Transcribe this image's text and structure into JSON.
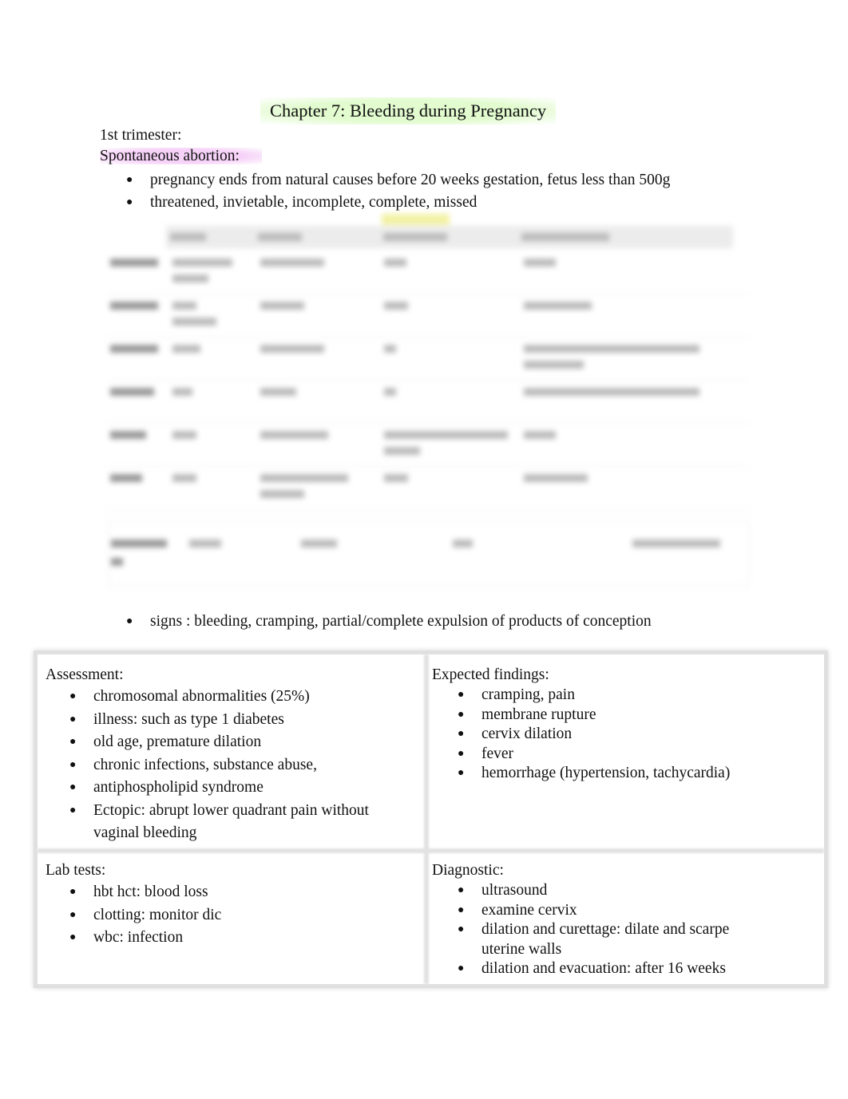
{
  "document": {
    "title": "Chapter 7: Bleeding during Pregnancy",
    "section": "1st trimester:",
    "subsection": "Spontaneous abortion:",
    "bullets": [
      "pregnancy ends from natural causes before 20 weeks gestation, fetus less than 500g",
      "threatened, invietable, incomplete, complete, missed"
    ],
    "table_note": "Table content is blurred / not legible",
    "signs": "signs : bleeding, cramping, partial/complete expulsion of products of conception",
    "highlight_colors": {
      "title": "#e2fbcf",
      "subsection": "#f6d2f8",
      "table_chip": "#f2f2a6"
    }
  },
  "grid": {
    "assessment": {
      "heading": "Assessment:",
      "items": [
        "chromosomal abnormalities (25%)",
        "illness: such as type 1 diabetes",
        "old age, premature dilation",
        "chronic infections, substance abuse,",
        "antiphospholipid syndrome",
        "Ectopic: abrupt lower quadrant pain without vaginal bleeding"
      ]
    },
    "expected_findings": {
      "heading": "Expected findings:",
      "items": [
        "cramping, pain",
        "membrane rupture",
        "cervix dilation",
        "fever",
        "hemorrhage (hypertension, tachycardia)"
      ]
    },
    "lab_tests": {
      "heading": "Lab tests:",
      "items": [
        "hbt hct: blood loss",
        "clotting: monitor dic",
        "wbc: infection"
      ]
    },
    "diagnostic": {
      "heading": "Diagnostic:",
      "items": [
        "ultrasound",
        "examine cervix",
        "dilation and curettage: dilate and scarpe uterine walls",
        "dilation and evacuation: after 16 weeks"
      ]
    }
  },
  "bullet_glyph": "●"
}
